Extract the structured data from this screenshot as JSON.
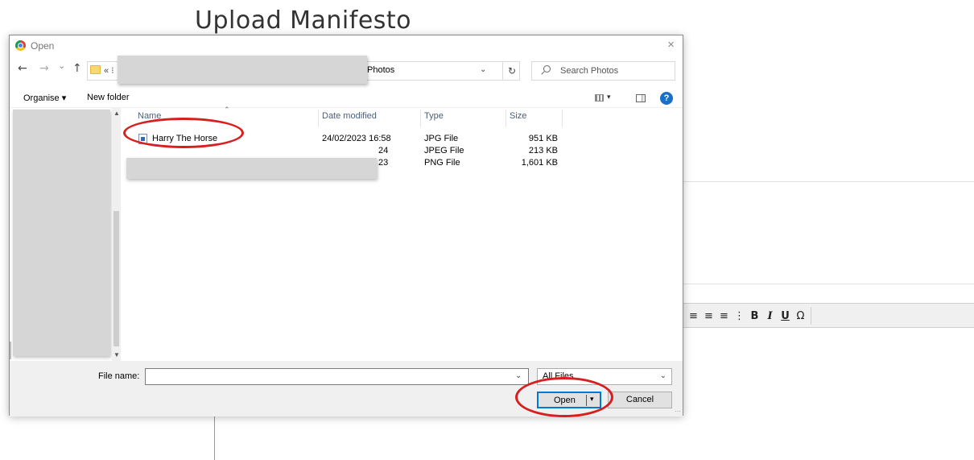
{
  "page": {
    "title": "Upload Manifesto"
  },
  "dialog": {
    "title": "Open",
    "close": "×",
    "nav": {
      "back": "←",
      "forward": "→",
      "recent": "⌄",
      "up": "↑"
    },
    "address": {
      "chevrons": "« ⁝",
      "arrow": "›",
      "current": "Photos",
      "dropdown": "⌄",
      "refresh": "↻"
    },
    "search": {
      "placeholder": "Search Photos"
    },
    "commands": {
      "organise": "Organise ▾",
      "new_folder": "New folder",
      "view_arrow": "▾",
      "help": "?"
    },
    "columns": {
      "name": "Name",
      "date": "Date modified",
      "type": "Type",
      "size": "Size"
    },
    "files": [
      {
        "name": "Harry The Horse",
        "date": "24/02/2023 16:58",
        "type": "JPG File",
        "size": "951 KB"
      },
      {
        "name": "",
        "date": "24/02/2023 16:24",
        "type": "JPEG File",
        "size": "213 KB"
      },
      {
        "name": "",
        "date": "24/02/2023 16:23",
        "type": "PNG File",
        "size": "1,601 KB"
      }
    ],
    "partial": {
      "row2_date": "24",
      "row3_date": "23"
    },
    "footer": {
      "file_name_label": "File name:",
      "file_name_value": "",
      "file_type": "All Files",
      "open": "Open",
      "open_arrow": "▾",
      "cancel": "Cancel"
    }
  },
  "editor_toolbar": {
    "buttons": [
      "⇶",
      "≡",
      "⒈",
      "⁝≡",
      "B",
      "I",
      "U",
      "Ω"
    ]
  },
  "colors": {
    "annotation": "#d81e1e",
    "accent": "#0078d7"
  }
}
